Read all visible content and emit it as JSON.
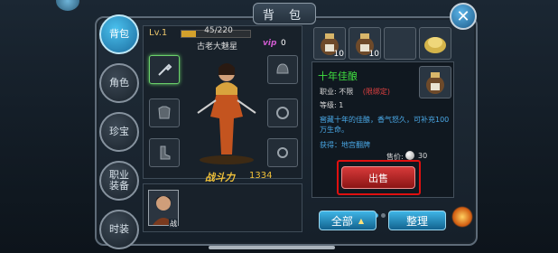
{
  "window": {
    "title": "背 包",
    "close_icon": "close-icon"
  },
  "tabs": [
    {
      "label": "背包",
      "active": true
    },
    {
      "label": "角色",
      "active": false
    },
    {
      "label": "珍宝",
      "active": false
    },
    {
      "label": "职业装备",
      "active": false
    },
    {
      "label": "时装",
      "active": false
    }
  ],
  "character": {
    "level_label": "Lv.1",
    "exp_text": "45/220",
    "exp_progress": 0.2045,
    "name": "古老大魅星",
    "vip_label": "vip",
    "vip_level": "0",
    "power_label": "战斗力",
    "power_value": "1334",
    "portrait_badge": "战"
  },
  "equipment_slots": [
    {
      "name": "weapon-slot",
      "icon": "shovel-icon"
    },
    {
      "name": "armor-slot",
      "icon": "armor-icon"
    },
    {
      "name": "boots-slot",
      "icon": "boots-icon"
    },
    {
      "name": "helmet-slot",
      "icon": "helmet-icon"
    },
    {
      "name": "ring-slot",
      "icon": "ring-icon"
    },
    {
      "name": "ring2-slot",
      "icon": "ring-icon"
    }
  ],
  "inventory": [
    {
      "count": "10",
      "icon": "wine-jar-icon"
    },
    {
      "count": "10",
      "icon": "wine-jar-icon"
    },
    {
      "count": "",
      "icon": "empty"
    },
    {
      "count": "",
      "icon": "gold-pile-icon"
    }
  ],
  "item_detail": {
    "name": "十年佳酿",
    "profession_label": "职业: 不限",
    "limit_text": "(限绑定)",
    "level_text": "等级: 1",
    "description": "窖藏十年的佳酿，香气怒久，可补充100万生命。",
    "source": "获得：地宫翻牌",
    "price_label": "售价:",
    "price_value": "30",
    "sell_button": "出售"
  },
  "bottom": {
    "all_button": "全部",
    "sort_button": "整理"
  },
  "colors": {
    "accent": "#3fb5e6",
    "sell": "#d83a3a",
    "power": "#f1c23a",
    "highlight": "#e01010"
  }
}
